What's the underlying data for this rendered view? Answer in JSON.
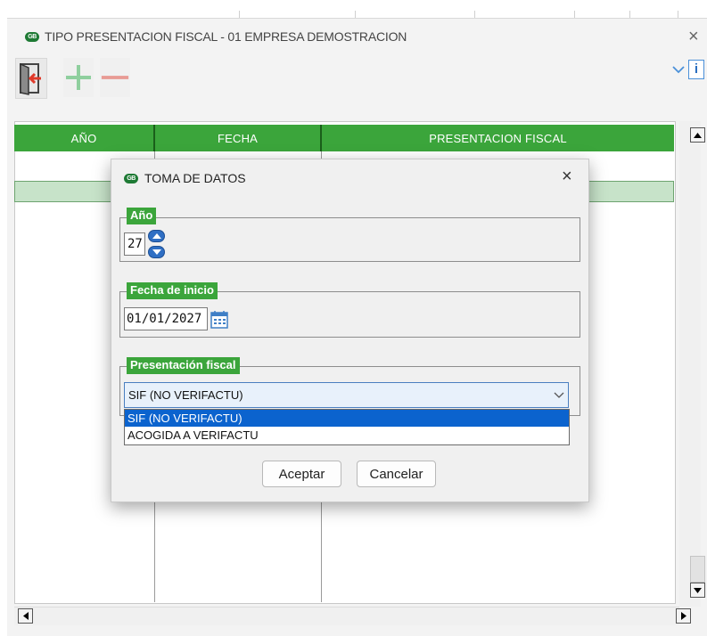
{
  "window": {
    "title": "TIPO PRESENTACION FISCAL - 01 EMPRESA DEMOSTRACION",
    "logo_text": "GB",
    "close_glyph": "×",
    "info_glyph": "i"
  },
  "toolbar": {
    "icons": [
      "exit-icon",
      "add-icon",
      "remove-icon"
    ],
    "colors": {
      "add": "#8fcf9e",
      "remove": "#e89a94",
      "exit_arrow": "#e03a2a"
    }
  },
  "grid": {
    "columns": [
      "AÑO",
      "FECHA",
      "PRESENTACION FISCAL"
    ],
    "header_color": "#3ba53b",
    "selected_row_color": "#c7e3c9"
  },
  "dialog": {
    "title": "TOMA DE DATOS",
    "close_glyph": "×",
    "year": {
      "label": "Año",
      "value": "27"
    },
    "start_date": {
      "label": "Fecha de inicio",
      "value": "01/01/2027"
    },
    "fiscal": {
      "label": "Presentación fiscal",
      "selected": "SIF (NO VERIFACTU)",
      "options": [
        "SIF (NO VERIFACTU)",
        "ACOGIDA A VERIFACTU"
      ],
      "highlighted_index": 0
    },
    "buttons": {
      "accept": "Aceptar",
      "cancel": "Cancelar"
    }
  },
  "colors": {
    "accent_green": "#3ba53b",
    "selection_blue": "#0b63ce",
    "spin_blue": "#2f6fc4"
  }
}
